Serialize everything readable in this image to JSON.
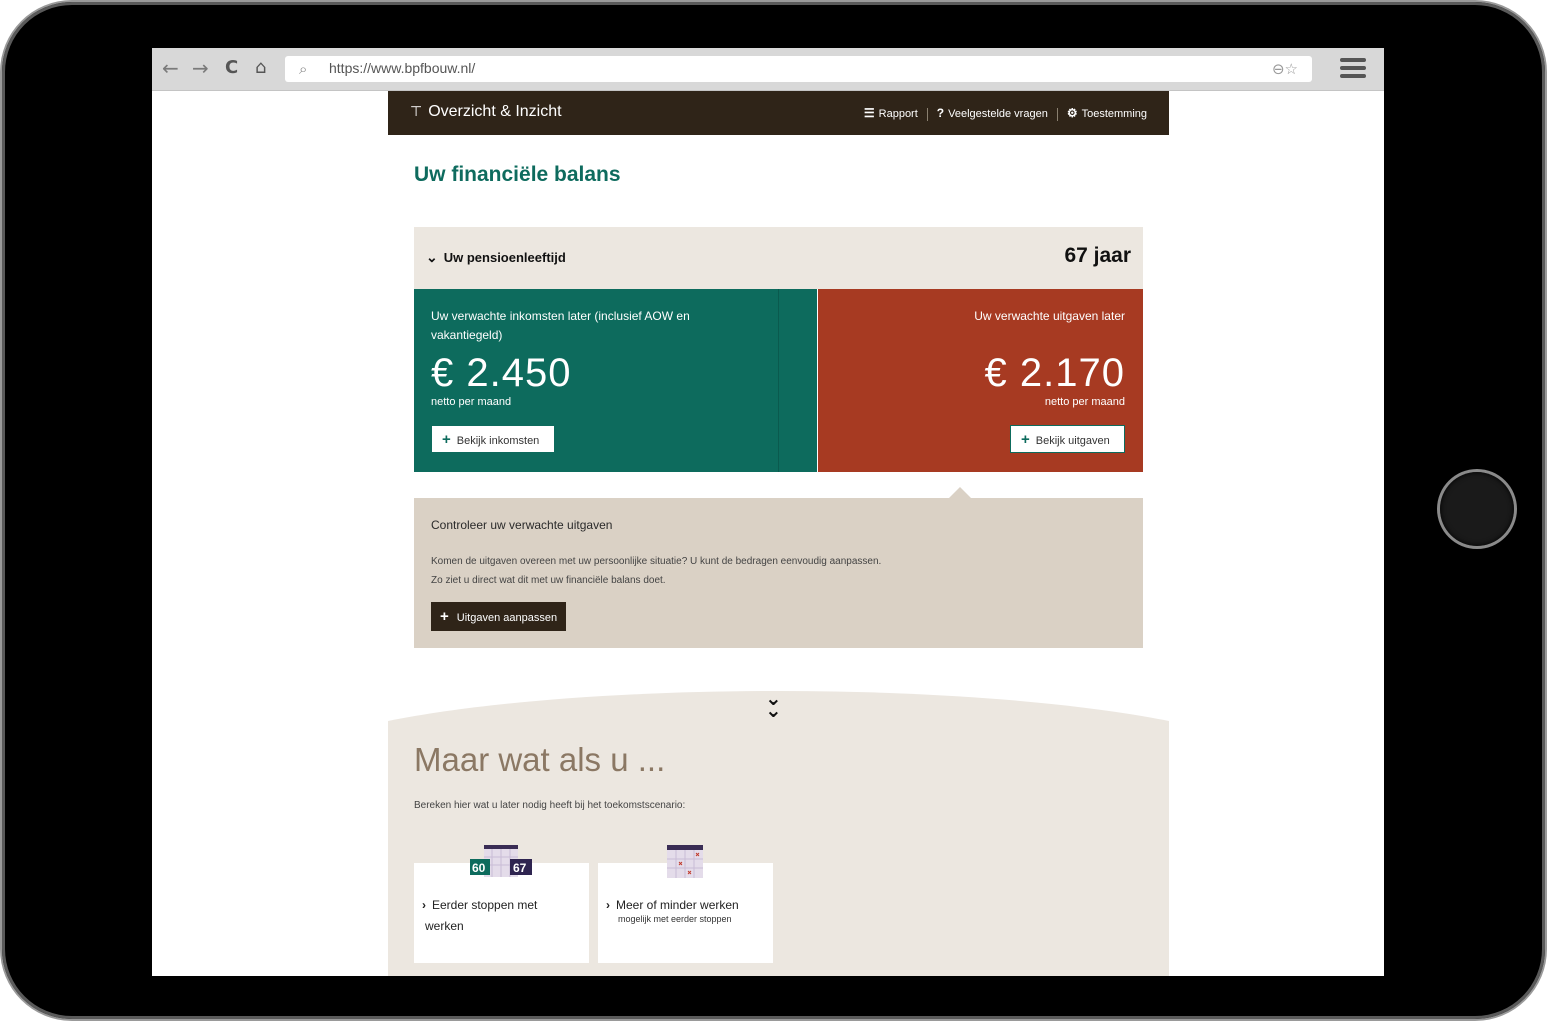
{
  "browser": {
    "url": "https://www.bpfbouw.nl/",
    "back_icon": "←",
    "forward_icon": "→",
    "reload_icon": "C",
    "home_icon": "⌂"
  },
  "topbar": {
    "brand": "Overzicht & Inzicht",
    "links": {
      "rapport": "Rapport",
      "faq": "Veelgestelde vragen",
      "consent": "Toestemming"
    }
  },
  "page": {
    "title": "Uw financiële balans",
    "age": {
      "label": "Uw pensioenleeftijd",
      "value": "67 jaar"
    },
    "income": {
      "title": "Uw verwachte inkomsten later (inclusief AOW en vakantiegeld)",
      "amount": "€ 2.450",
      "sub": "netto per maand",
      "button": "Bekijk inkomsten"
    },
    "expense": {
      "title": "Uw verwachte uitgaven later",
      "amount": "€ 2.170",
      "sub": "netto per maand",
      "button": "Bekijk uitgaven"
    },
    "check": {
      "title": "Controleer uw verwachte uitgaven",
      "line1": "Komen de uitgaven overeen met uw persoonlijke situatie? U kunt de bedragen eenvoudig aanpassen.",
      "line2": "Zo ziet u direct wat dit met uw financiële balans doet.",
      "button": "Uitgaven aanpassen"
    },
    "scenario": {
      "heading": "Maar wat als u ...",
      "intro": "Bereken hier wat u later nodig heeft bij het toekomstscenario:",
      "cards": [
        {
          "line1": "Eerder stoppen met",
          "line2": "werken",
          "icon_left": "60",
          "icon_right": "67"
        },
        {
          "line1": "Meer of minder werken",
          "sub": "mogelijk met eerder stoppen"
        }
      ]
    }
  },
  "colors": {
    "brand_green": "#0d6b5d",
    "expense_red": "#a73a22",
    "topbar_dark": "#2f2418",
    "beige": "#dad1c5"
  }
}
